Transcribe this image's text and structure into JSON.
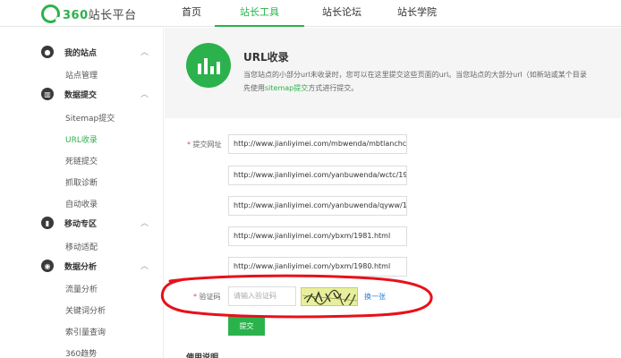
{
  "logo": {
    "prefix": "360",
    "text": "站长平台"
  },
  "nav": [
    "首页",
    "站长工具",
    "站长论坛",
    "站长学院"
  ],
  "sidebar": {
    "sections": [
      {
        "label": "我的站点",
        "items": [
          "站点管理"
        ]
      },
      {
        "label": "数据提交",
        "items": [
          "Sitemap提交",
          "URL收录",
          "死链提交",
          "抓取诊断",
          "自动收录"
        ]
      },
      {
        "label": "移动专区",
        "items": [
          "移动适配"
        ]
      },
      {
        "label": "数据分析",
        "items": [
          "流量分析",
          "关键词分析",
          "索引量查询",
          "360趋势"
        ]
      }
    ],
    "active_item": "URL收录"
  },
  "header": {
    "title": "URL收录",
    "desc_line1": "当您站点的小部分url未收录时，您可以在这里提交这些页面的url。当您站点的大部分url（如新站或某个目录",
    "desc_line2_prefix": "先使用",
    "desc_line2_link": "sitemap提交",
    "desc_line2_suffix": "方式进行提交。"
  },
  "form": {
    "url_label": "提交网址",
    "urls": [
      "http://www.jianliyimei.com/mbwenda/mbtlanchc",
      "http://www.jianliyimei.com/yanbuwenda/wctc/19",
      "http://www.jianliyimei.com/yanbuwenda/qyww/1",
      "http://www.jianliyimei.com/ybxm/1981.html",
      "http://www.jianliyimei.com/ybxm/1980.html"
    ],
    "captcha_label": "验证码",
    "captcha_placeholder": "请输入验证码",
    "captcha_refresh": "换一张",
    "submit_label": "提交"
  },
  "usage_title": "使用说明",
  "colors": {
    "accent": "#2bb24c",
    "annotation": "#e8101a",
    "link": "#2a7fd4"
  }
}
